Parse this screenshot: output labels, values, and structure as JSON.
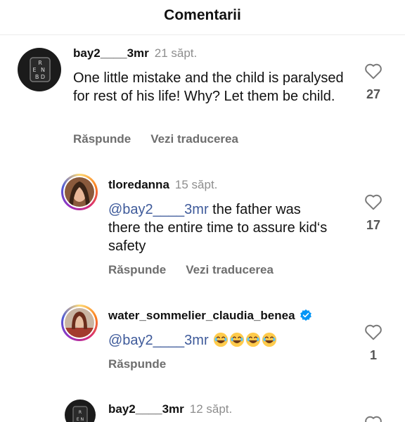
{
  "header": {
    "title": "Comentarii"
  },
  "comments": [
    {
      "username": "bay2____3mr",
      "time": "21 săpt.",
      "text": "One little mistake and the child is paralysed for rest of his life! Why? Let them be child.",
      "likes": "27",
      "reply_label": "Răspunde",
      "translate_label": "Vezi traducerea"
    },
    {
      "username": "tloredanna",
      "time": "15 săpt.",
      "mention": "@bay2____3mr",
      "text": " the father was there the entire time to assure kid‘s safety",
      "likes": "17",
      "reply_label": "Răspunde",
      "translate_label": "Vezi traducerea"
    },
    {
      "username": "water_sommelier_claudia_benea",
      "verified": true,
      "mention": "@bay2____3mr",
      "emoji": "😂😂😂😂",
      "likes": "1",
      "reply_label": "Răspunde"
    },
    {
      "username": "bay2____3mr",
      "time": "12 săpt."
    }
  ],
  "colors": {
    "mention": "#3e5a9a",
    "verified": "#0095f6",
    "muted": "#8e8e8e"
  }
}
